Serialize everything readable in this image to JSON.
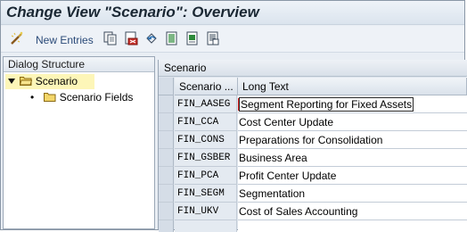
{
  "window": {
    "title": "Change View \"Scenario\": Overview"
  },
  "toolbar": {
    "new_entries_label": "New Entries",
    "icons": [
      "copy-icon",
      "delete-icon",
      "undo-icon",
      "select-all-icon",
      "select-block-icon",
      "deselect-all-icon"
    ]
  },
  "dialog_structure": {
    "header": "Dialog Structure",
    "items": [
      {
        "label": "Scenario",
        "level": 0,
        "expanded": true,
        "selected": true
      },
      {
        "label": "Scenario Fields",
        "level": 1,
        "expanded": false,
        "selected": false
      }
    ]
  },
  "table": {
    "title": "Scenario",
    "columns": [
      "Scenario ...",
      "Long Text"
    ],
    "rows": [
      {
        "scenario": "FIN_AASEG",
        "long_text": "Segment Reporting for Fixed Assets"
      },
      {
        "scenario": "FIN_CCA",
        "long_text": "Cost Center Update"
      },
      {
        "scenario": "FIN_CONS",
        "long_text": "Preparations for Consolidation"
      },
      {
        "scenario": "FIN_GSBER",
        "long_text": "Business Area"
      },
      {
        "scenario": "FIN_PCA",
        "long_text": "Profit Center Update"
      },
      {
        "scenario": "FIN_SEGM",
        "long_text": "Segmentation"
      },
      {
        "scenario": "FIN_UKV",
        "long_text": "Cost of Sales Accounting"
      }
    ]
  },
  "colors": {
    "selected_tree_bg": "#fdf6b8",
    "label_blue": "#2a4a78",
    "grid_key_bg": "#e4eaf1"
  }
}
